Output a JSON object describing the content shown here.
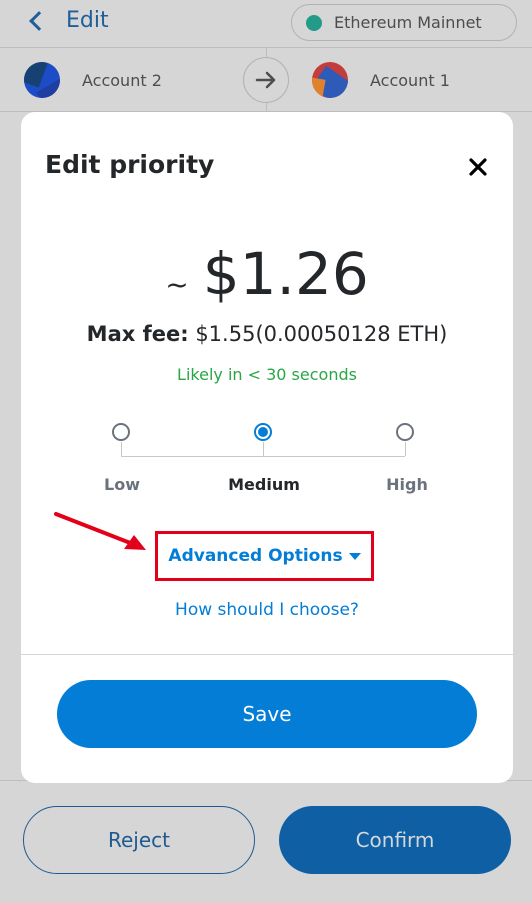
{
  "header": {
    "back_label": "Edit",
    "network_label": "Ethereum Mainnet",
    "network_color": "#249a88"
  },
  "accounts": {
    "from": "Account 2",
    "to": "Account 1",
    "arrow_icon": "arrow-right-icon"
  },
  "footer": {
    "reject_label": "Reject",
    "confirm_label": "Confirm"
  },
  "modal": {
    "title": "Edit priority",
    "close_icon": "close-icon",
    "fee_tilde": "~",
    "fee_amount": "$1.26",
    "max_fee_label": "Max fee:",
    "max_fee_value": "$1.55",
    "max_fee_eth": "(0.00050128 ETH)",
    "likely_text": "Likely in < 30 seconds",
    "priorities": [
      {
        "label": "Low",
        "selected": false
      },
      {
        "label": "Medium",
        "selected": true
      },
      {
        "label": "High",
        "selected": false
      }
    ],
    "advanced_label": "Advanced Options",
    "how_label": "How should I choose?",
    "save_label": "Save"
  },
  "colors": {
    "accent": "#037dd6",
    "success": "#28a745",
    "highlight": "#e4001b"
  }
}
